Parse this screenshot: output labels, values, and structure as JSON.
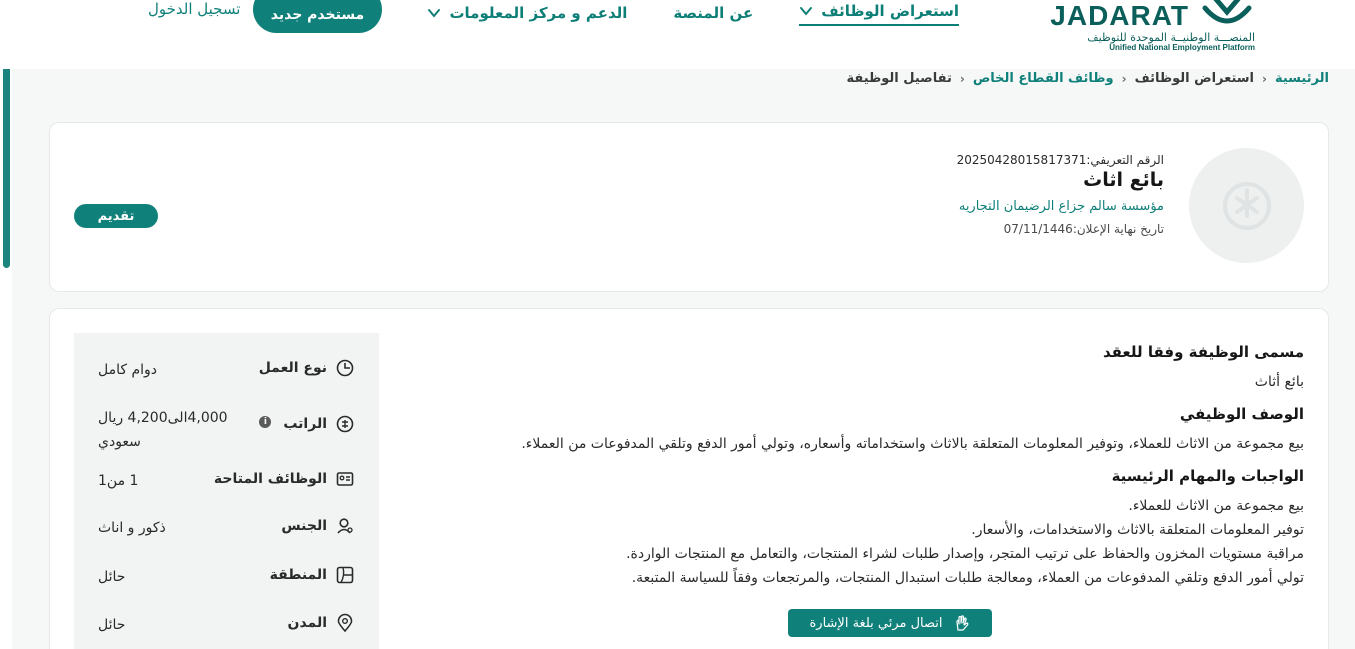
{
  "header": {
    "logo_word": "JADARAT",
    "logo_ar": "المنصـــة الوطنيــة الموحدة للتوظيف",
    "logo_en": "Unified National Employment Platform",
    "nav": [
      {
        "label": "استعراض الوظائف",
        "has_dropdown": true,
        "active": true
      },
      {
        "label": "عن المنصة",
        "has_dropdown": false,
        "active": false
      },
      {
        "label": "الدعم و مركز المعلومات",
        "has_dropdown": true,
        "active": false
      }
    ],
    "signup_label": "مستخدم جديد",
    "login_label": "تسجيل الدخول"
  },
  "breadcrumb": [
    {
      "label": "الرئيسية",
      "link": true
    },
    {
      "label": "استعراض الوظائف",
      "link": false
    },
    {
      "label": "وظائف القطاع الخاص",
      "link": true
    },
    {
      "label": "تفاصيل الوظيفة",
      "link": false
    }
  ],
  "job": {
    "id_text": "الرقم التعريفي:20250428015817371",
    "title": "بائع اثاث",
    "company": "مؤسسة سالم جزاع الرضيمان التجاريه",
    "deadline_text": "تاريخ نهاية الإعلان:07/11/1446",
    "apply_label": "تقديم"
  },
  "attributes": [
    {
      "label": "نوع العمل",
      "value": "دوام كامل",
      "icon": "clock-icon"
    },
    {
      "label": "الراتب",
      "value": "4,000الى4,200 ريال سعودي",
      "icon": "salary-icon",
      "info": true
    },
    {
      "label": "الوظائف المتاحة",
      "value": "1 من1",
      "icon": "vacancies-icon"
    },
    {
      "label": "الجنس",
      "value": "ذكور و اناث",
      "icon": "gender-icon"
    },
    {
      "label": "المنطقة",
      "value": "حائل",
      "icon": "region-map-icon"
    },
    {
      "label": "المدن",
      "value": "حائل",
      "icon": "location-pin-icon"
    }
  ],
  "content": {
    "contract_title_heading": "مسمى الوظيفة وفقا للعقد",
    "contract_title": "بائع أثاث",
    "description_heading": "الوصف الوظيفي",
    "description": "بيع مجموعة من الاثاث للعملاء، وتوفير المعلومات المتعلقة بالاثاث واستخداماته وأسعاره، وتولي أمور الدفع وتلقي المدفوعات من العملاء.",
    "duties_heading": "الواجبات والمهام الرئيسية",
    "duties": [
      "بيع مجموعة من الاثاث للعملاء.",
      "توفير المعلومات المتعلقة بالاثاث والاستخدامات، والأسعار.",
      "مراقبة مستويات المخزون والحفاظ على ترتيب المتجر، وإصدار طلبات لشراء المنتجات، والتعامل مع المنتجات الواردة.",
      "تولي أمور الدفع وتلقي المدفوعات من العملاء، ومعالجة طلبات استبدال المنتجات، والمرتجعات وفقاً للسياسة المتبعة."
    ],
    "sign_language_label": "اتصال مرئي بلغة الإشارة"
  }
}
